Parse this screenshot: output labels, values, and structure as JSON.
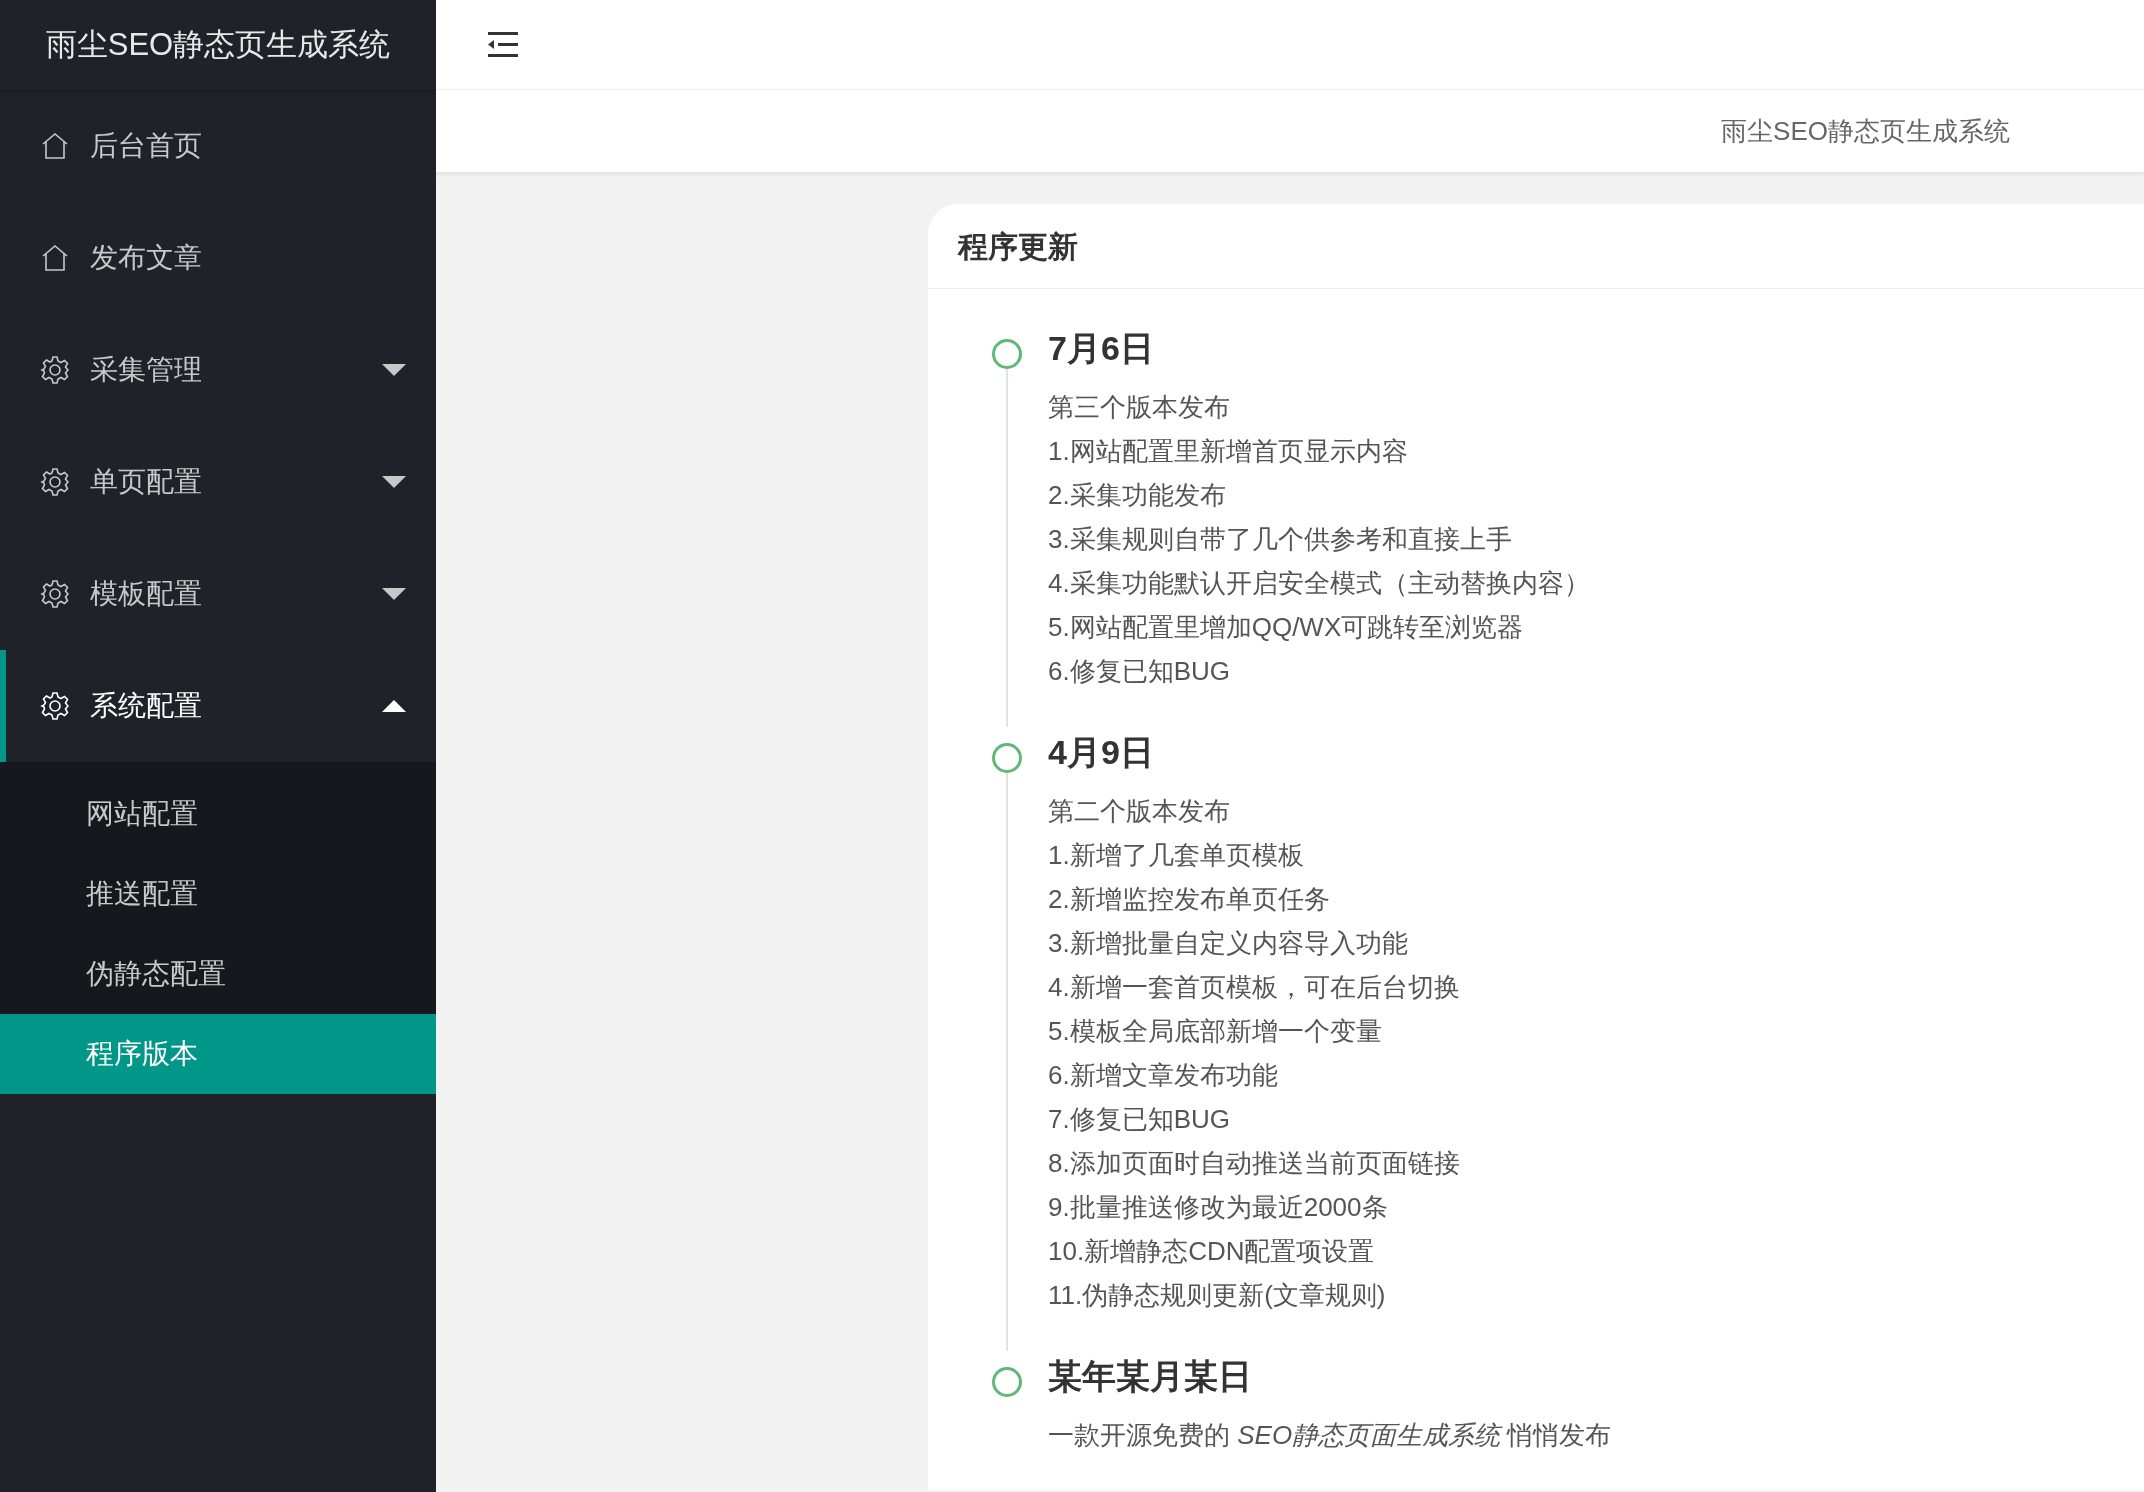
{
  "sidebar": {
    "logo": "雨尘SEO静态页生成系统",
    "items": [
      {
        "label": "后台首页",
        "kind": "link",
        "selected": false
      },
      {
        "label": "发布文章",
        "kind": "link",
        "selected": false
      },
      {
        "label": "采集管理",
        "kind": "group",
        "expanded": false,
        "selected": false
      },
      {
        "label": "单页配置",
        "kind": "group",
        "expanded": false,
        "selected": false
      },
      {
        "label": "模板配置",
        "kind": "group",
        "expanded": false,
        "selected": false
      },
      {
        "label": "系统配置",
        "kind": "group",
        "expanded": true,
        "selected": true,
        "children": [
          {
            "label": "网站配置",
            "selected": false
          },
          {
            "label": "推送配置",
            "selected": false
          },
          {
            "label": "伪静态配置",
            "selected": false
          },
          {
            "label": "程序版本",
            "selected": true
          }
        ]
      }
    ]
  },
  "header": {
    "subtitle": "雨尘SEO静态页生成系统"
  },
  "card": {
    "title": "程序更新",
    "timeline": [
      {
        "date": "7月6日",
        "lines": [
          "第三个版本发布",
          "1.网站配置里新增首页显示内容",
          "2.采集功能发布",
          "3.采集规则自带了几个供参考和直接上手",
          "4.采集功能默认开启安全模式（主动替换内容）",
          "5.网站配置里增加QQ/WX可跳转至浏览器",
          "6.修复已知BUG"
        ]
      },
      {
        "date": "4月9日",
        "lines": [
          "第二个版本发布",
          "1.新增了几套单页模板",
          "2.新增监控发布单页任务",
          "3.新增批量自定义内容导入功能",
          "4.新增一套首页模板，可在后台切换",
          "5.模板全局底部新增一个变量",
          "6.新增文章发布功能",
          "7.修复已知BUG",
          "8.添加页面时自动推送当前页面链接",
          "9.批量推送修改为最近2000条",
          "10.新增静态CDN配置项设置",
          "11.伪静态规则更新(文章规则)"
        ]
      },
      {
        "date": "某年某月某日",
        "lines": [
          "一款开源免费的 *SEO静态页面生成系统* 悄悄发布"
        ]
      }
    ]
  }
}
